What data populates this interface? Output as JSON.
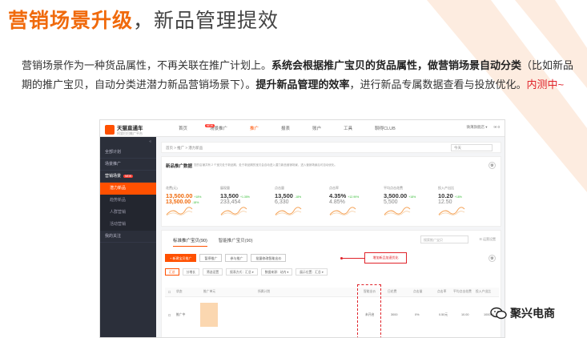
{
  "slide": {
    "title_highlight": "营销场景升级",
    "title_sep": "，",
    "title_rest": "新品管理提效",
    "desc_1": "营销场景作为一种货品属性，不再关联在推广计划上。",
    "desc_2": "系统会根据推广宝贝的货品属性，做营销场景自动分类",
    "desc_3": "（比如新品期的推广宝贝，自动分类进潜力新品营销场景下）。",
    "desc_4": "提升新品管理的效率",
    "desc_5": "，进行新品专属数据查看与投放优化。",
    "desc_6": "内测中~"
  },
  "app": {
    "brand": "天猫直通车",
    "brand_sub": "阿里巴巴推广平台",
    "nav": [
      "首页",
      "场景推广",
      "推广",
      "报表",
      "账户",
      "工具",
      "聊得CLUB"
    ],
    "nav_new_badge": "NEW",
    "top_user": "微薄旗舰店 ▾",
    "top_msg": "✉ 0",
    "side_collapse": "«",
    "side_items": {
      "plan": "全部计划",
      "scene_plan": "场景推广",
      "scene_group": "营销场景",
      "scene_new": "NEW",
      "sub_new": "潜力新品",
      "sub_hot": "趋势新品",
      "sub_pop": "人群营销",
      "sub_act": "活动营销",
      "recent": "我的关注"
    },
    "crumb": "首页  >  推广  >  潜力新品",
    "crumb_select": "今天",
    "data_card": {
      "title": "新品推广数据",
      "hint": "您的店铺共有 2 个宝贝处于新品期，处于新品期的宝贝会自动进入潜力新品营销场景，进入营销场景后可自动优化。",
      "gear": "⚙",
      "metrics": [
        {
          "label": "花费(元)",
          "v1": "13,500.00",
          "v1_note": "+18%",
          "v2": "13,500.00",
          "v2_note": "-18%"
        },
        {
          "label": "展现量",
          "v1": "13,500",
          "v1_note": "+1.35%",
          "v2": "233,454",
          "v2_note": ""
        },
        {
          "label": "点击量",
          "v1": "13,500",
          "v1_note": "-18%",
          "v2": "6,330",
          "v2_note": ""
        },
        {
          "label": "点击率",
          "v1": "4.35%",
          "v1_note": "+12.99%",
          "v2": "4.85%",
          "v2_note": ""
        },
        {
          "label": "平均点击花费",
          "v1": "3,500.00",
          "v1_note": "+18%",
          "v2": "5,500",
          "v2_note": ""
        },
        {
          "label": "投入产出比",
          "v1": "10.20",
          "v1_note": "+18%",
          "v2": "12.50",
          "v2_note": ""
        }
      ]
    },
    "list_card": {
      "tab_standard": "标准推广宝贝(90)",
      "tab_smart": "智能推广宝贝(90)",
      "search_placeholder": "搜索推广宝贝",
      "right_link": "☰ 运营设置",
      "btn_add": "+ 新建宝贝推广",
      "btn_pause": "暂停推广",
      "btn_resume": "参与推广",
      "btn_batch": "批量修改智能出价",
      "callout": "增加新品加速优化",
      "filters": [
        "汇总",
        "分增长",
        "筛选设置",
        "报表方式：汇总 ▾",
        "数据来源：站内 ▾",
        "展示位置：汇总 ▾"
      ],
      "columns": [
        "状态",
        "推广单元",
        "所属计划",
        "智能出价",
        "日花费",
        "点击量",
        "点击率",
        "平均点击花费",
        "投入产出比",
        "直接成交金额"
      ],
      "row": [
        "推广中",
        "",
        "",
        "未开启",
        "3000",
        "0%",
        "0.50元",
        "10.00",
        "100000"
      ]
    }
  },
  "watermark": "聚兴电商"
}
